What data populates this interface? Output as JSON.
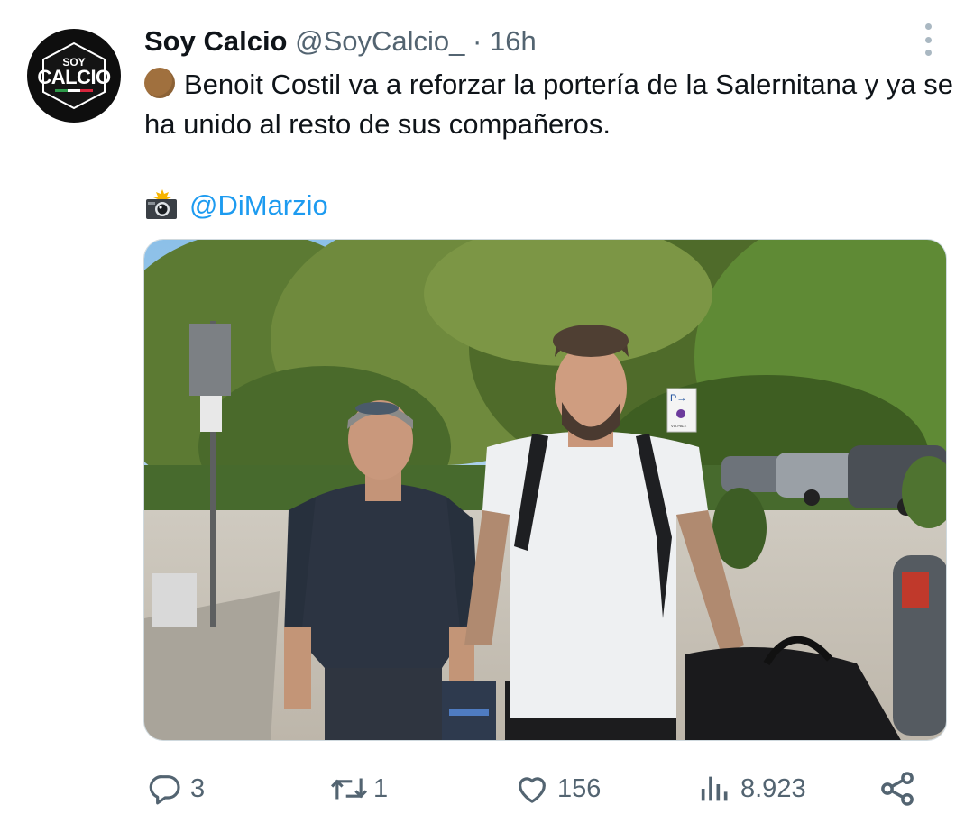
{
  "tweet": {
    "author_name": "Soy Calcio",
    "author_handle": "@SoyCalcio_",
    "separator": "·",
    "time": "16h",
    "avatar_text_top": "SOY",
    "avatar_text_main": "CALCIO",
    "text_line": "Benoit Costil va a reforzar la portería de la Salernitana y ya se ha unido al resto de sus compañeros.",
    "credit_mention": "@DiMarzio",
    "leading_emoji": "brown-circle-icon",
    "credit_emoji": "camera-with-flash-icon"
  },
  "media": {
    "sign_parking": "P→",
    "sign_small_text": "VIA PALE"
  },
  "actions": {
    "replies": "3",
    "reposts": "1",
    "likes": "156",
    "views": "8.923"
  },
  "colors": {
    "accent": "#1d9bf0",
    "secondary_text": "#536471",
    "primary_text": "#0f1419"
  }
}
